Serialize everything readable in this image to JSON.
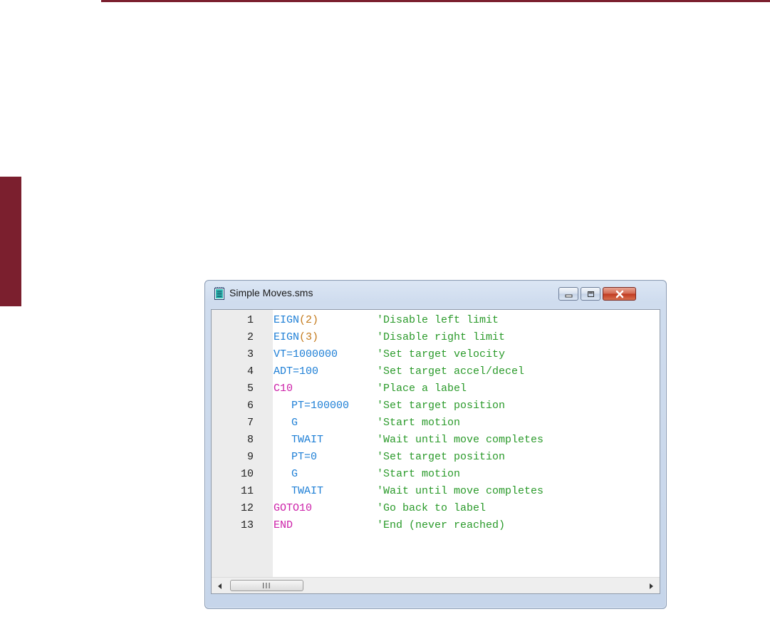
{
  "window": {
    "title": "Simple Moves.sms",
    "controls": {
      "minimize": "minimize",
      "maximize": "maximize",
      "close": "close"
    }
  },
  "scrollbar": {
    "grip_label": "III"
  },
  "code_lines": [
    {
      "num": "1",
      "parts": [
        {
          "t": "EIGN",
          "c": "kw-blue"
        },
        {
          "t": "(2)",
          "c": "paren"
        }
      ],
      "indent": false,
      "comment": "'Disable left limit"
    },
    {
      "num": "2",
      "parts": [
        {
          "t": "EIGN",
          "c": "kw-blue"
        },
        {
          "t": "(3)",
          "c": "paren"
        }
      ],
      "indent": false,
      "comment": "'Disable right limit"
    },
    {
      "num": "3",
      "parts": [
        {
          "t": "VT=1000000",
          "c": "kw-blue"
        }
      ],
      "indent": false,
      "comment": "'Set target velocity"
    },
    {
      "num": "4",
      "parts": [
        {
          "t": "ADT=100",
          "c": "kw-blue"
        }
      ],
      "indent": false,
      "comment": "'Set target accel/decel"
    },
    {
      "num": "5",
      "parts": [
        {
          "t": "C10",
          "c": "kw-pink"
        }
      ],
      "indent": false,
      "comment": "'Place a label"
    },
    {
      "num": "6",
      "parts": [
        {
          "t": "PT=100000",
          "c": "kw-blue"
        }
      ],
      "indent": true,
      "comment": "'Set target position"
    },
    {
      "num": "7",
      "parts": [
        {
          "t": "G",
          "c": "kw-blue"
        }
      ],
      "indent": true,
      "comment": "'Start motion"
    },
    {
      "num": "8",
      "parts": [
        {
          "t": "TWAIT",
          "c": "kw-blue"
        }
      ],
      "indent": true,
      "comment": "'Wait until move completes"
    },
    {
      "num": "9",
      "parts": [
        {
          "t": "PT=0",
          "c": "kw-blue"
        }
      ],
      "indent": true,
      "comment": "'Set target position"
    },
    {
      "num": "10",
      "parts": [
        {
          "t": "G",
          "c": "kw-blue"
        }
      ],
      "indent": true,
      "comment": "'Start motion"
    },
    {
      "num": "11",
      "parts": [
        {
          "t": "TWAIT",
          "c": "kw-blue"
        }
      ],
      "indent": true,
      "comment": "'Wait until move completes"
    },
    {
      "num": "12",
      "parts": [
        {
          "t": "GOTO10",
          "c": "kw-pink"
        }
      ],
      "indent": false,
      "comment": "'Go back to label"
    },
    {
      "num": "13",
      "parts": [
        {
          "t": "END",
          "c": "kw-pink"
        }
      ],
      "indent": false,
      "comment": "'End (never reached)"
    }
  ],
  "colors": {
    "brand_accent": "#7b1f2e",
    "keyword": "#1e7fd6",
    "label_keyword": "#cc1fa8",
    "argument": "#c47a1c",
    "comment": "#2a9a2a"
  }
}
